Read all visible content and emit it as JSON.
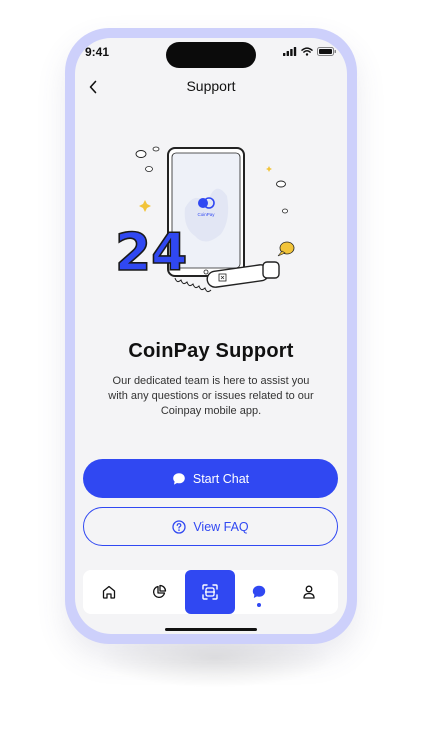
{
  "status_bar": {
    "time": "9:41"
  },
  "header": {
    "title": "Support"
  },
  "illustration": {
    "brand_label": "CoinPay",
    "hours_label": "24"
  },
  "content": {
    "title": "CoinPay Support",
    "description": "Our dedicated team is here to assist you with any questions or issues related to our Coinpay mobile app."
  },
  "actions": {
    "start_chat": "Start Chat",
    "view_faq": "View FAQ"
  },
  "tab_bar": {
    "items": [
      {
        "icon": "home-icon"
      },
      {
        "icon": "pie-chart-icon"
      },
      {
        "icon": "scan-icon",
        "active": true
      },
      {
        "icon": "chat-icon",
        "current": true
      },
      {
        "icon": "profile-icon"
      }
    ]
  },
  "colors": {
    "accent": "#3048f2",
    "phone_frame": "#cdd0fb",
    "screen_bg": "#f4f4f6"
  }
}
